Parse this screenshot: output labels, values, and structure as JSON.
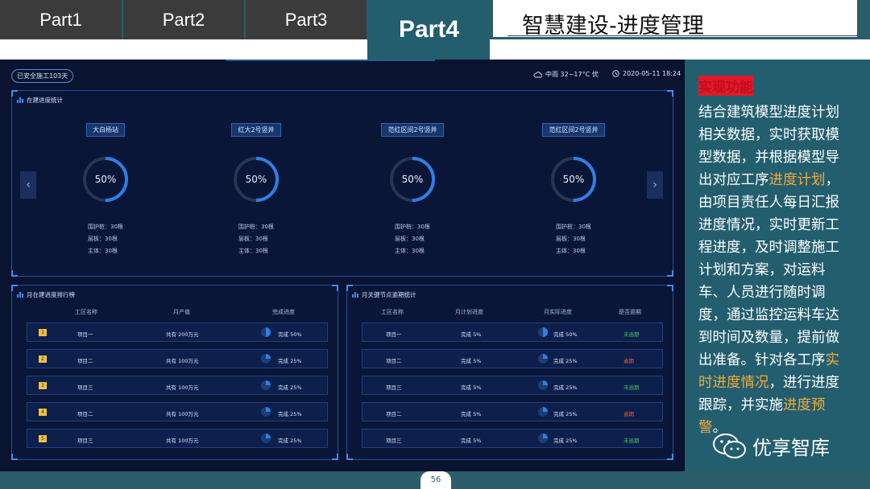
{
  "tabs": [
    "Part1",
    "Part2",
    "Part3",
    "Part4"
  ],
  "title": "智慧建设-进度管理",
  "dashboard": {
    "safe_days": "已安全施工103天",
    "weather": "中雨 32~17°C 优",
    "datetime": "2020-05-11 18:24",
    "progress_panel_title": "在建进度统计",
    "sites": [
      {
        "name": "大白杨站",
        "percent": "50%",
        "value": 0.5,
        "stats": [
          "围护桩：30根",
          "层板：30根",
          "主体：30根"
        ]
      },
      {
        "name": "红大2号竖井",
        "percent": "50%",
        "value": 0.5,
        "stats": [
          "围护桩：30根",
          "层板：30根",
          "主体：30根"
        ]
      },
      {
        "name": "范红区间2号竖井",
        "percent": "50%",
        "value": 0.5,
        "stats": [
          "围护桩：30根",
          "层板：30根",
          "主体：30根"
        ]
      },
      {
        "name": "范红区间2号竖井",
        "percent": "50%",
        "value": 0.5,
        "stats": [
          "围护桩：30根",
          "层板：30根",
          "主体：30根"
        ]
      }
    ],
    "arrow_left": "‹",
    "arrow_right": "›",
    "ranking": {
      "title": "月在建进度排行榜",
      "headers": [
        "工区名称",
        "月产值",
        "完成进度"
      ],
      "rows": [
        {
          "rank": "1",
          "name": "项目一",
          "value": "共有 200万元",
          "progress": "完成 50%",
          "fraction": 0.5
        },
        {
          "rank": "2",
          "name": "项目二",
          "value": "共有 100万元",
          "progress": "完成 25%",
          "fraction": 0.25
        },
        {
          "rank": "3",
          "name": "项目三",
          "value": "共有 100万元",
          "progress": "完成 25%",
          "fraction": 0.25
        },
        {
          "rank": "4",
          "name": "项目二",
          "value": "共有 100万元",
          "progress": "完成 25%",
          "fraction": 0.25
        },
        {
          "rank": "5",
          "name": "项目三",
          "value": "共有 100万元",
          "progress": "完成 25%",
          "fraction": 0.25
        }
      ]
    },
    "milestones": {
      "title": "月关键节点逾期统计",
      "headers": [
        "工区名称",
        "月计划进度",
        "月实际进度",
        "是否逾期"
      ],
      "rows": [
        {
          "name": "项目一",
          "plan": "完成 5%",
          "actual": "完成 50%",
          "fraction": 0.5,
          "status": "未逾期",
          "status_color": "#3cc36a"
        },
        {
          "name": "项目二",
          "plan": "完成 5%",
          "actual": "完成 25%",
          "fraction": 0.25,
          "status": "逾期",
          "status_color": "#f05a3a"
        },
        {
          "name": "项目三",
          "plan": "完成 5%",
          "actual": "完成 25%",
          "fraction": 0.25,
          "status": "未逾期",
          "status_color": "#3cc36a"
        },
        {
          "name": "项目二",
          "plan": "完成 5%",
          "actual": "完成 25%",
          "fraction": 0.25,
          "status": "逾期",
          "status_color": "#f05a3a"
        },
        {
          "name": "项目三",
          "plan": "完成 5%",
          "actual": "完成 25%",
          "fraction": 0.25,
          "status": "未逾期",
          "status_color": "#3cc36a"
        }
      ]
    }
  },
  "sidebar": {
    "heading": "实现功能",
    "parts": [
      {
        "text": "结合建筑模型进度计划相关数据，实时获取模型数据，并根据模型导出对应工序",
        "hl": false
      },
      {
        "text": "进度计划",
        "hl": true
      },
      {
        "text": "，由项目责任人每日汇报进度情况，实时更新工程进度，及时调整施工计划和方案，对运料车、人员进行随时调度，通过监控运料车达到时间及数量，提前做出准备。针对各工序",
        "hl": false
      },
      {
        "text": "实时进度情况",
        "hl": true
      },
      {
        "text": "，进行进度跟踪，并实施",
        "hl": false
      },
      {
        "text": "进度预警",
        "hl": true
      },
      {
        "text": "。",
        "hl": false
      }
    ]
  },
  "watermark": "优享智库",
  "page_number": "56",
  "colors": {
    "accent": "#2f7fe8",
    "highlight": "#f2a93b",
    "teal": "#235e6e"
  }
}
